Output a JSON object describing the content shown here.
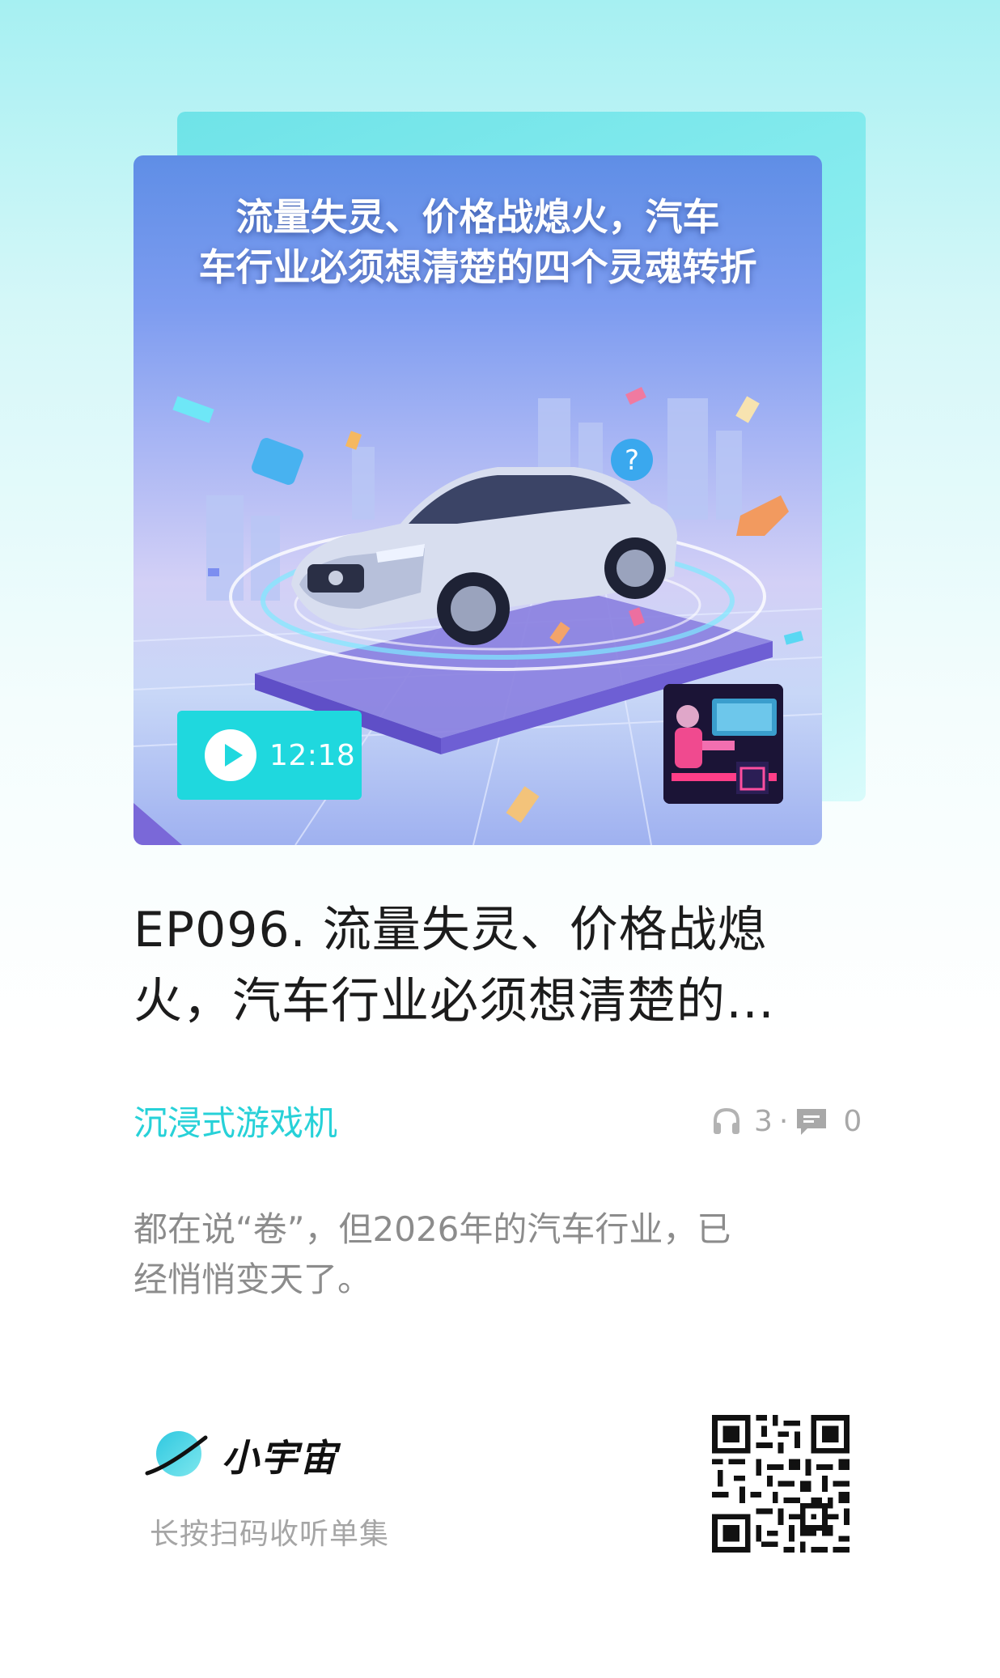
{
  "cover": {
    "title_line1": "流量失灵、价格战熄火，汽车",
    "title_line2": "车行业必须想清楚的四个灵魂转折",
    "duration": "12:18"
  },
  "episode": {
    "title_line1": "EP096. 流量失灵、价格战熄",
    "title_line2": "火，汽车行业必须想清楚的…"
  },
  "podcast": {
    "name": "沉浸式游戏机"
  },
  "stats": {
    "plays": "3",
    "separator": "·",
    "comments": "0"
  },
  "description": {
    "line1": "都在说“卷”，但2026年的汽车行业，已",
    "line2": "经悄悄变天了。"
  },
  "footer": {
    "brand": "小宇宙",
    "scan_hint": "长按扫码收听单集"
  },
  "colors": {
    "accent": "#27d1d8",
    "duration_chip": "#1fd8de",
    "title_text": "#1c1c1c",
    "muted_text": "#8c8c8c"
  },
  "icons": {
    "play": "play-icon",
    "headphones": "headphones-icon",
    "comment": "comment-icon",
    "logo": "xiaoyuzhou-planet-logo",
    "qr": "qr-code"
  }
}
